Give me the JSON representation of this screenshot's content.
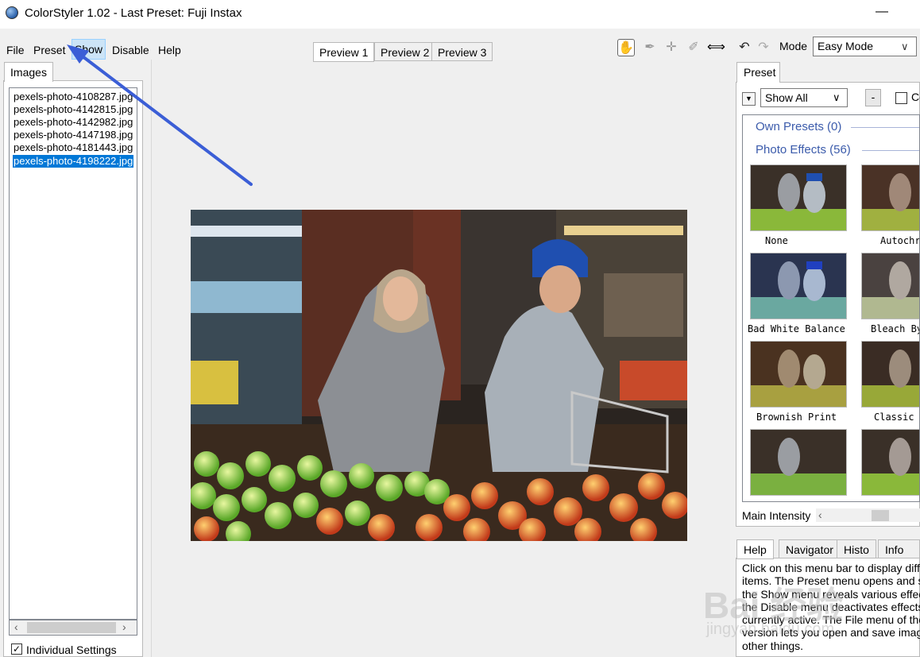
{
  "window": {
    "title": "ColorStyler 1.02 - Last Preset: Fuji Instax",
    "minimize_glyph": "—"
  },
  "menu": {
    "file": "File",
    "preset": "Preset",
    "show": "Show",
    "disable": "Disable",
    "help": "Help"
  },
  "preview_tabs": [
    "Preview 1",
    "Preview 2",
    "Preview 3"
  ],
  "toolbar": {
    "tools": [
      "hand-tool-icon",
      "eyedropper-icon",
      "crosshair-icon",
      "brush-icon",
      "split-view-icon"
    ],
    "mode_label": "Mode",
    "mode_value": "Easy Mode"
  },
  "images_panel": {
    "tab": "Images",
    "files": [
      "pexels-photo-4108287.jpg",
      "pexels-photo-4142815.jpg",
      "pexels-photo-4142982.jpg",
      "pexels-photo-4147198.jpg",
      "pexels-photo-4181443.jpg",
      "pexels-photo-4198222.jpg"
    ],
    "selected_index": 5,
    "individual_settings_label": "Individual Settings",
    "individual_settings_checked": true
  },
  "preset_panel": {
    "tab": "Preset",
    "filter_value": "Show All",
    "minus_label": "-",
    "checkbox_label": "Co",
    "groups": [
      {
        "name": "Own Presets (0)"
      },
      {
        "name": "Photo Effects (56)"
      }
    ],
    "presets": [
      "None",
      "Autochr",
      "Bad White Balance",
      "Bleach By",
      "Brownish Print",
      "Classic"
    ],
    "main_intensity_label": "Main Intensity"
  },
  "info_tabs": [
    "Help",
    "Navigator",
    "Histo",
    "Info"
  ],
  "help_text": "Click on this menu bar to display differe\nitems. The Preset menu opens and sa\nthe Show menu reveals various effect\nthe Disable menu deactivates effects\ncurrently active. The File menu of the\nversion lets you open and save image\nother things.",
  "watermark": {
    "main": "Bai 经验",
    "sub": "jingyan.baidu.com"
  }
}
